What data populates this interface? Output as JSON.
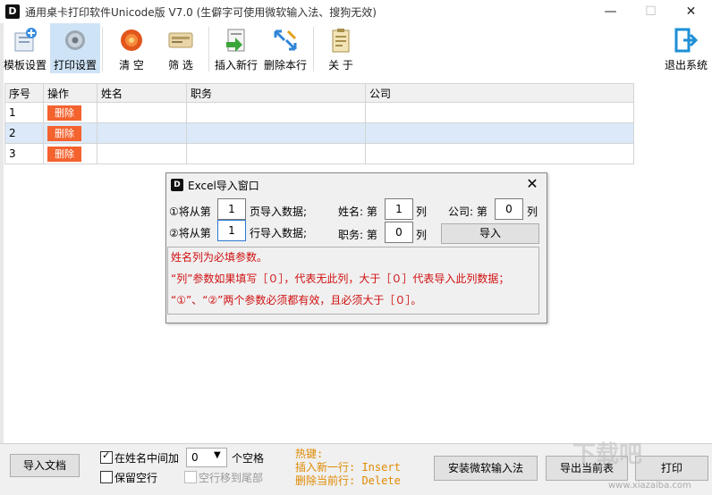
{
  "window": {
    "title": "通用桌卡打印软件Unicode版  V7.0  (生僻字可使用微软输入法、搜狗无效)",
    "logo": "D",
    "controls": {
      "minimize": "—",
      "maximize": "☐",
      "close": "✕"
    }
  },
  "toolbar": {
    "template": "模板设置",
    "print_settings": "打印设置",
    "clear": "清    空",
    "filter": "筛    选",
    "insert_row": "插入新行",
    "delete_row": "删除本行",
    "about": "关    于",
    "exit": "退出系统"
  },
  "grid": {
    "columns": [
      "序号",
      "操作",
      "姓名",
      "职务",
      "公司"
    ],
    "rows": [
      {
        "no": "1",
        "action": "删除",
        "name": "",
        "title": "",
        "company": ""
      },
      {
        "no": "2",
        "action": "删除",
        "name": "",
        "title": "",
        "company": ""
      },
      {
        "no": "3",
        "action": "删除",
        "name": "",
        "title": "",
        "company": ""
      }
    ],
    "selected_row": 2
  },
  "dialog": {
    "logo": "D",
    "title": "Excel导入窗口",
    "close": "✕",
    "row1": {
      "prefix": "①将从第",
      "value": "1",
      "suffix": "页导入数据;"
    },
    "row2": {
      "prefix": "②将从第",
      "value": "1",
      "suffix": "行导入数据;"
    },
    "name": {
      "label": "姓名: 第",
      "value": "1",
      "unit": "列"
    },
    "company": {
      "label": "公司: 第",
      "value": "0",
      "unit": "列"
    },
    "position": {
      "label": "职务: 第",
      "value": "0",
      "unit": "列"
    },
    "import_button": "导入",
    "notes": [
      "姓名列为必填参数。",
      "“列”参数如果填写［０］，代表无此列，大于［０］代表导入此列数据；",
      "“①”、“②”两个参数必须都有效，且必须大于［０］。"
    ],
    "note_color": "#d01010"
  },
  "bottom": {
    "import_doc": "导入文档",
    "insert_in_name": "在姓名中间加",
    "insert_in_name_checked": true,
    "spaces_value": "0",
    "spaces_unit": "个空格",
    "keep_empty": "保留空行",
    "keep_empty_checked": false,
    "move_empty": "空行移到尾部",
    "move_empty_checked": false,
    "hotkeys_title": "热键:",
    "hotkey_insert": "插入新一行: Insert",
    "hotkey_delete": "删除当前行: Delete",
    "install_ime": "安装微软输入法",
    "export_table": "导出当前表",
    "print": "打印"
  },
  "watermark": {
    "text": "下载吧",
    "url": "www.xiazaiba.com"
  },
  "colors": {
    "delete_button": "#f4622e",
    "selected_row": "#dbe9f8",
    "hotkey_text": "#e08a00"
  }
}
